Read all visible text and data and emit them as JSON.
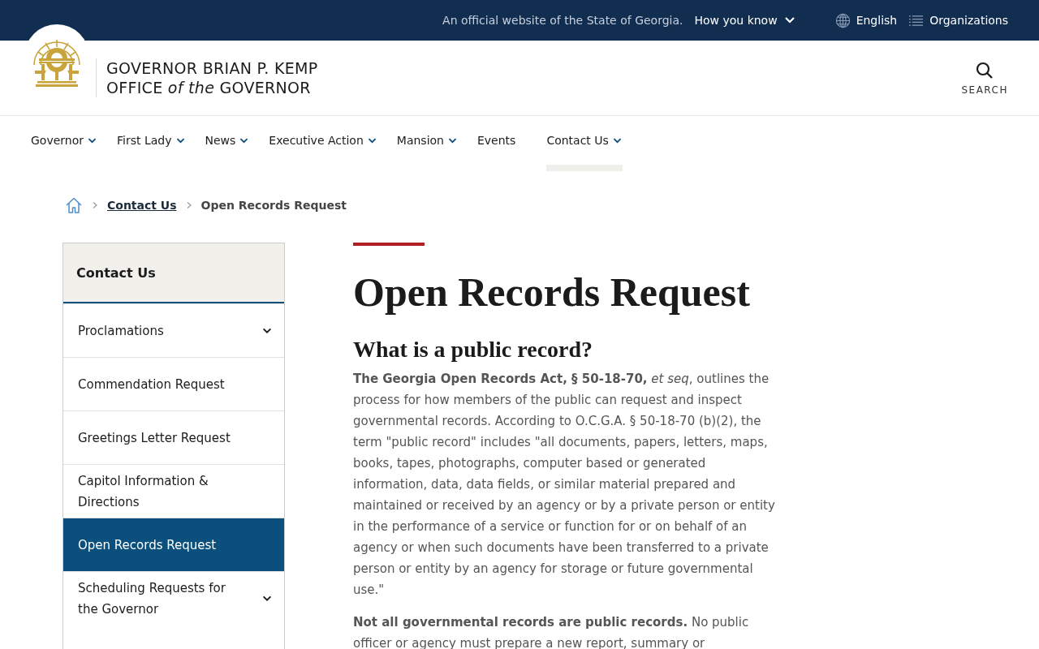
{
  "top_bar": {
    "notice": "An official website of the State of Georgia.",
    "how_you_know": "How you know",
    "language": "English",
    "organizations": "Organizations"
  },
  "header": {
    "title_line_1": "GOVERNOR BRIAN P. KEMP",
    "title_line_2": "OFFICE *of the* GOVERNOR",
    "search": "SEARCH"
  },
  "nav": [
    {
      "label": "Governor",
      "has_menu": true,
      "selected": false
    },
    {
      "label": "First Lady",
      "has_menu": true,
      "selected": false
    },
    {
      "label": "News",
      "has_menu": true,
      "selected": false
    },
    {
      "label": "Executive Action",
      "has_menu": true,
      "selected": false
    },
    {
      "label": "Mansion",
      "has_menu": true,
      "selected": false
    },
    {
      "label": "Events",
      "has_menu": false,
      "selected": false
    },
    {
      "label": "Contact Us",
      "has_menu": true,
      "selected": true
    }
  ],
  "breadcrumb": [
    {
      "label": "Contact Us",
      "kind": "link"
    },
    {
      "label": "Open Records Request",
      "kind": "current"
    }
  ],
  "sidebar": {
    "title": "Contact Us",
    "items": [
      {
        "label": "Proclamations",
        "has_menu": true,
        "selected": false
      },
      {
        "label": "Commendation Request",
        "has_menu": false,
        "selected": false
      },
      {
        "label": "Greetings Letter Request",
        "has_menu": false,
        "selected": false
      },
      {
        "label": "Capitol Information & Directions",
        "has_menu": false,
        "selected": false
      },
      {
        "label": "Open Records Request",
        "has_menu": false,
        "selected": true
      },
      {
        "label": "Scheduling Requests for the Governor",
        "has_menu": true,
        "selected": false
      }
    ]
  },
  "main": {
    "title": "Open Records Request",
    "section_heading": "What is a public record?",
    "paragraphs": [
      "**The Georgia Open Records Act, § 50-18-70,** *et seq*, outlines the process for how members of the public can request and inspect governmental records. According to O.C.G.A. § 50-18-70 (b)(2), the term \"public record\" includes \"all documents, papers, letters, maps, books, tapes, photographs, computer based or generated information, data, data fields, or similar material prepared and maintained or received by an agency or by a private person or entity in the performance of a service or function for or on behalf of an agency or when such documents have been transferred to a private person or entity by an agency for storage or future governmental use.\"",
      "**Not all governmental records are public records.** No public officer or agency must prepare a new report, summary or"
    ]
  }
}
